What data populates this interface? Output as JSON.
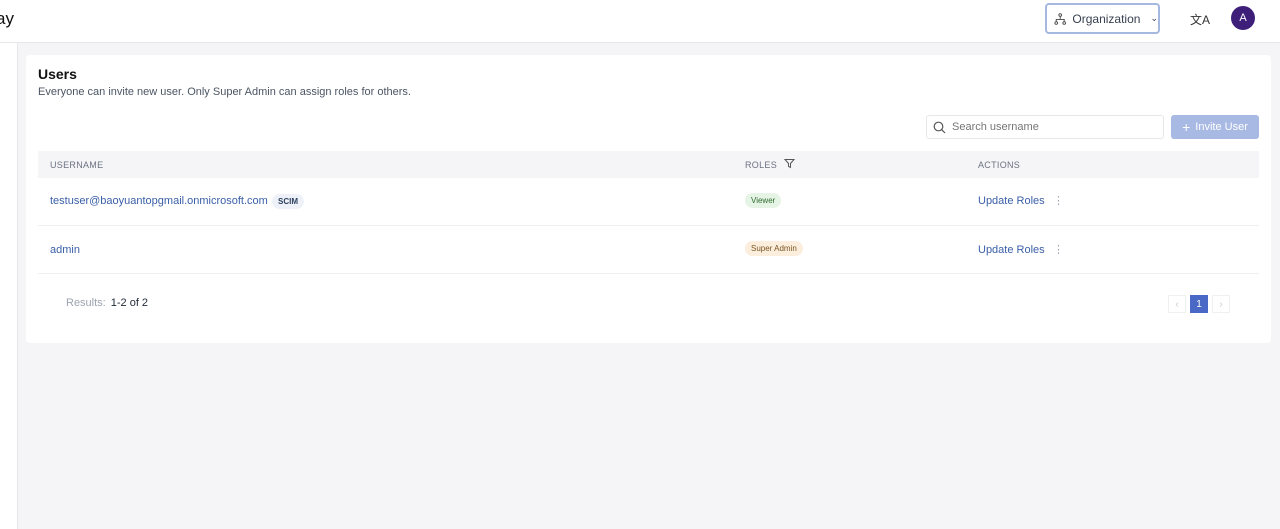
{
  "header": {
    "logo_text": "ay",
    "org_label": "Organization",
    "avatar_initial": "A",
    "translate_icon": "文A"
  },
  "users": {
    "title": "Users",
    "subtitle": "Everyone can invite new user. Only Super Admin can assign roles for others.",
    "search_placeholder": "Search username",
    "invite_label": "Invite User",
    "columns": {
      "username": "USERNAME",
      "roles": "ROLES",
      "actions": "ACTIONS"
    },
    "rows": [
      {
        "username": "testuser@baoyuantopgmail.onmicrosoft.com",
        "tag": "SCIM",
        "role": "Viewer",
        "role_color": "#e6f4e6",
        "action": "Update Roles"
      },
      {
        "username": "admin",
        "role": "Super Admin",
        "role_color": "#fbeedd",
        "action": "Update Roles"
      }
    ],
    "results_label": "Results:",
    "results_value": "1-2 of 2",
    "pagination": {
      "current": "1",
      "prev": "‹",
      "next": "›"
    }
  }
}
